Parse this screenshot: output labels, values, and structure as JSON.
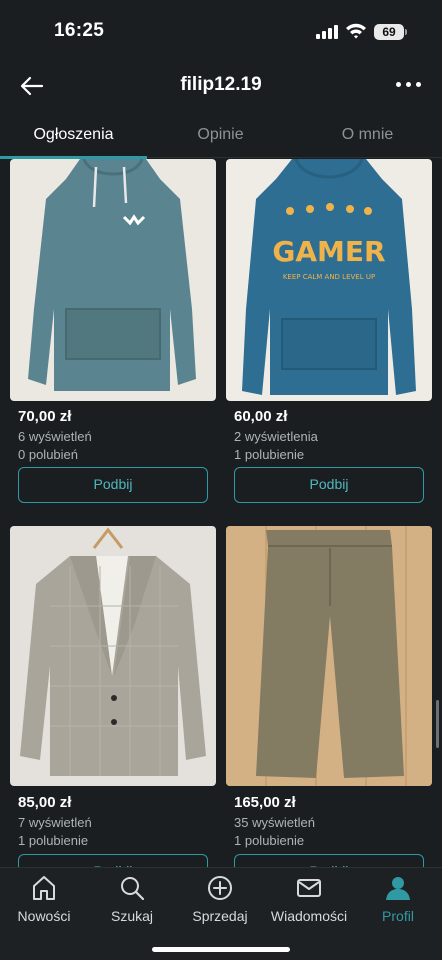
{
  "status_bar": {
    "time": "16:25",
    "battery": "69"
  },
  "header": {
    "title": "filip12.19"
  },
  "tabs": [
    {
      "label": "Ogłoszenia",
      "active": true
    },
    {
      "label": "Opinie",
      "active": false
    },
    {
      "label": "O mnie",
      "active": false
    }
  ],
  "listings": [
    {
      "price": "70,00 zł",
      "views": "6 wyświetleń",
      "likes": "0 polubień",
      "button": "Podbij",
      "image": "light blue hoodie"
    },
    {
      "price": "60,00 zł",
      "views": "2 wyświetlenia",
      "likes": "1 polubienie",
      "button": "Podbij",
      "image": "blue GAMER hoodie"
    },
    {
      "price": "85,00 zł",
      "views": "7 wyświetleń",
      "likes": "1 polubienie",
      "button": "Podbij",
      "image": "grey check blazer"
    },
    {
      "price": "165,00 zł",
      "views": "35 wyświetleń",
      "likes": "1 polubienie",
      "button": "Podbij",
      "image": "olive trousers"
    }
  ],
  "hoodie_print": {
    "main": "GAMER",
    "tagline": "KEEP CALM AND LEVEL UP"
  },
  "bottom_nav": [
    {
      "label": "Nowości",
      "icon": "home-icon"
    },
    {
      "label": "Szukaj",
      "icon": "search-icon"
    },
    {
      "label": "Sprzedaj",
      "icon": "plus-circle-icon"
    },
    {
      "label": "Wiadomości",
      "icon": "mail-icon"
    },
    {
      "label": "Profil",
      "icon": "profile-icon",
      "active": true
    }
  ],
  "colors": {
    "background": "#1b1e21",
    "accent": "#2f9aa3",
    "muted_text": "#aeb3b7"
  }
}
